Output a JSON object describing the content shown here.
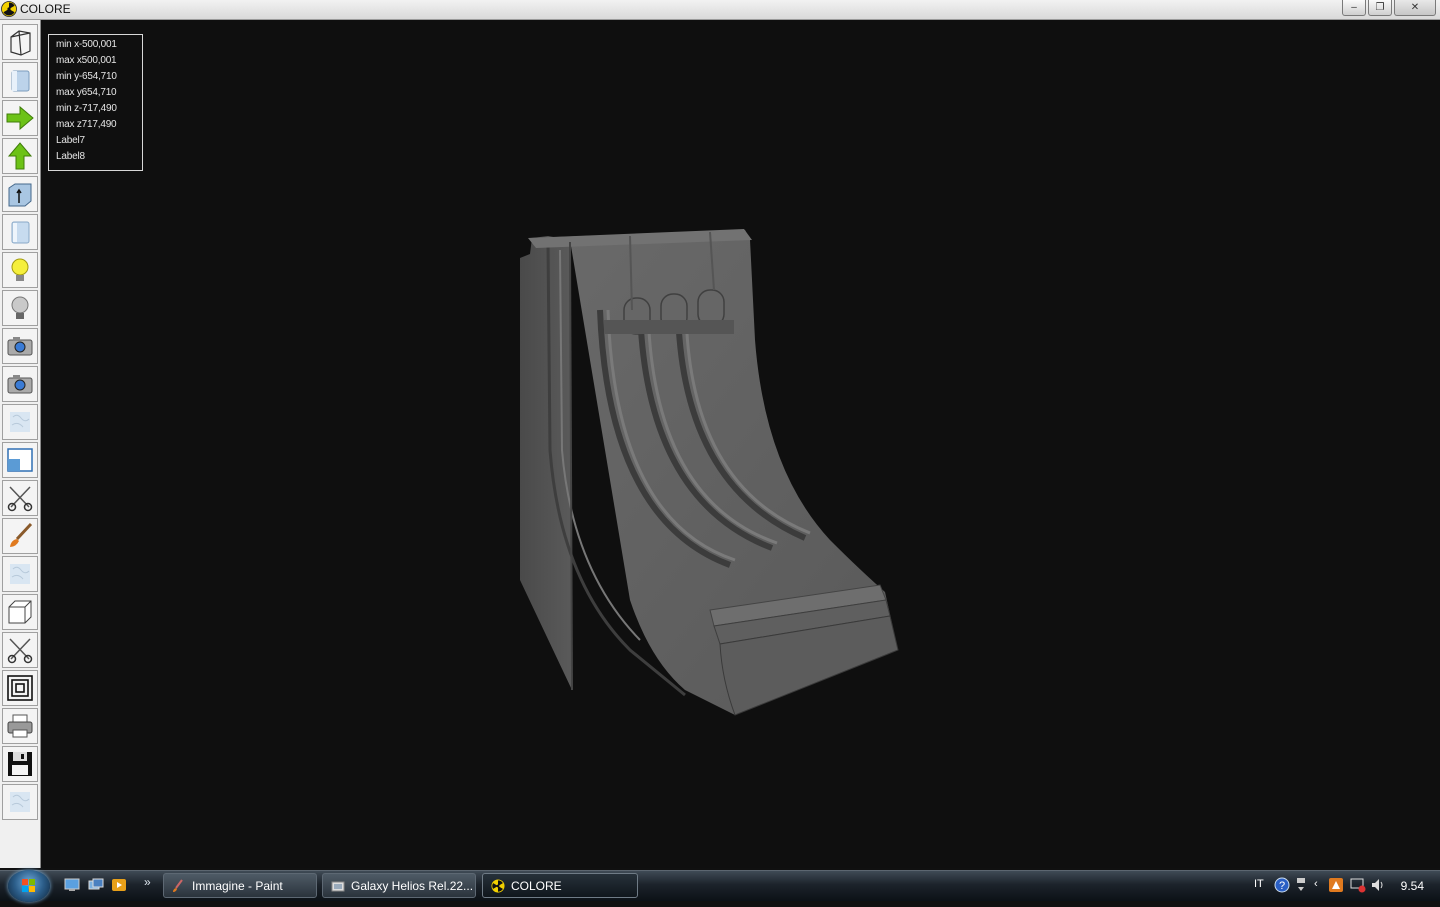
{
  "window": {
    "title": "COLORE",
    "app_icon": "radiation-icon",
    "controls": {
      "minimize": "minimize-icon",
      "restore": "restore-icon",
      "close": "close-icon"
    }
  },
  "toolbar": {
    "tools": [
      "wireframe-box-icon",
      "solid-cube-icon",
      "arrow-right-icon",
      "arrow-up-icon",
      "cube-arrow-icon",
      "cylinder-icon",
      "lightbulb-on-icon",
      "lightbulb-off-icon",
      "camera-icon",
      "camera-icon",
      "texture-icon",
      "window-resize-icon",
      "scissors-icon",
      "paintbrush-icon",
      "texture-icon",
      "box-icon",
      "scissors-icon",
      "concentric-squares-icon",
      "printer-icon",
      "floppy-disk-icon",
      "texture-icon"
    ]
  },
  "info": {
    "lines": [
      "min x-500,001",
      "max x500,001",
      "min y-654,710",
      "max y654,710",
      "min z-717,490",
      "max z717,490",
      "Label7",
      "Label8"
    ]
  },
  "taskbar": {
    "tasks": [
      {
        "label": "Immagine - Paint",
        "icon": "paint-icon"
      },
      {
        "label": "Galaxy Helios  Rel.22...",
        "icon": "folder-icon"
      },
      {
        "label": "COLORE",
        "icon": "radiation-icon"
      }
    ],
    "tray": {
      "language": "IT",
      "clock": "9.54"
    }
  },
  "colors": {
    "viewport_bg": "#101010",
    "model": "#5e5e5e",
    "info_border": "#d8d8d8"
  }
}
